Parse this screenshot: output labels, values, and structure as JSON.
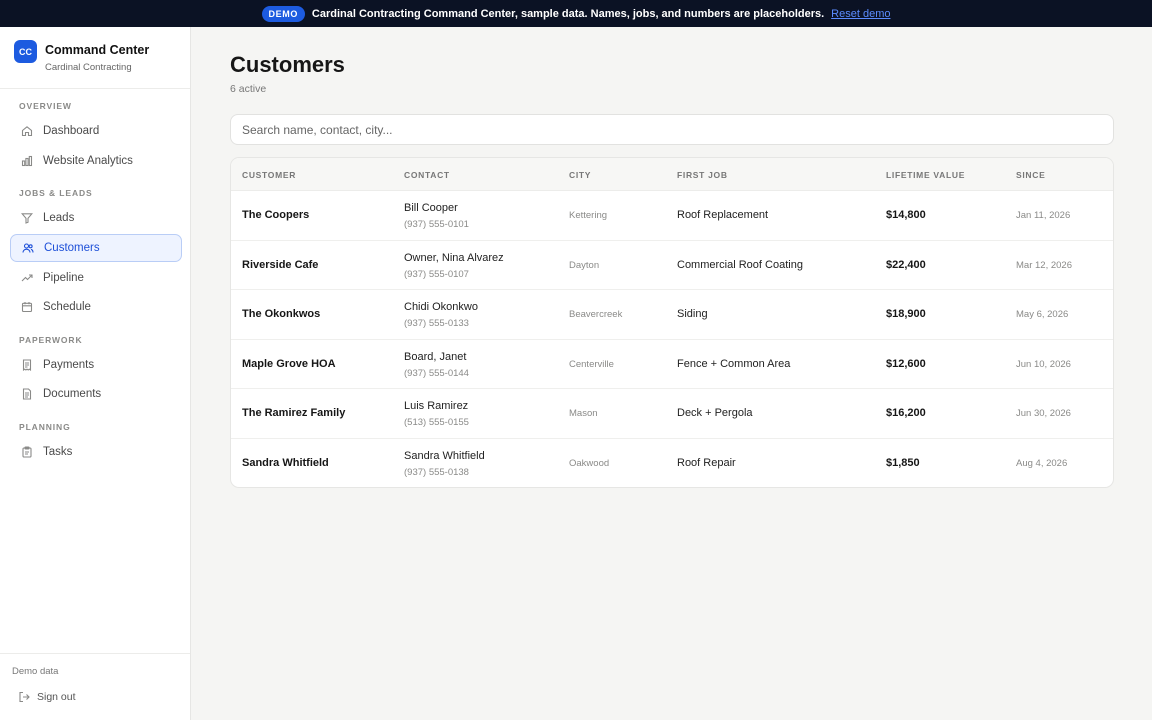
{
  "banner": {
    "badge": "DEMO",
    "message": "Cardinal Contracting Command Center, sample data. Names, jobs, and numbers are placeholders.",
    "reset_label": "Reset demo"
  },
  "brand": {
    "logo": "CC",
    "name": "Command Center",
    "company": "Cardinal Contracting",
    "accent": "#1d5be0"
  },
  "nav": {
    "sections": [
      {
        "label": "OVERVIEW"
      },
      {
        "label": "JOBS & LEADS"
      },
      {
        "label": "PAPERWORK"
      },
      {
        "label": "PLANNING"
      }
    ],
    "items": [
      {
        "label": "Dashboard",
        "icon": "home-icon"
      },
      {
        "label": "Website Analytics",
        "icon": "bar-chart-icon"
      },
      {
        "label": "Leads",
        "icon": "filter-icon"
      },
      {
        "label": "Customers",
        "icon": "users-icon",
        "active": true
      },
      {
        "label": "Pipeline",
        "icon": "trending-up-icon"
      },
      {
        "label": "Schedule",
        "icon": "calendar-icon"
      },
      {
        "label": "Payments",
        "icon": "receipt-icon"
      },
      {
        "label": "Documents",
        "icon": "file-icon"
      },
      {
        "label": "Tasks",
        "icon": "clipboard-icon"
      }
    ]
  },
  "footer": {
    "demo_label": "Demo data",
    "signout_label": "Sign out"
  },
  "page": {
    "title": "Customers",
    "subtitle": "6 active",
    "search_placeholder": "Search name, contact, city..."
  },
  "table": {
    "columns": [
      "CUSTOMER",
      "CONTACT",
      "CITY",
      "FIRST JOB",
      "LIFETIME VALUE",
      "SINCE"
    ],
    "rows": [
      {
        "customer": "The Coopers",
        "contact": "Bill Cooper",
        "phone": "(937) 555-0101",
        "city": "Kettering",
        "job": "Roof Replacement",
        "value": "$14,800",
        "since": "Jan 11, 2026"
      },
      {
        "customer": "Riverside Cafe",
        "contact": "Owner, Nina Alvarez",
        "phone": "(937) 555-0107",
        "city": "Dayton",
        "job": "Commercial Roof Coating",
        "value": "$22,400",
        "since": "Mar 12, 2026"
      },
      {
        "customer": "The Okonkwos",
        "contact": "Chidi Okonkwo",
        "phone": "(937) 555-0133",
        "city": "Beavercreek",
        "job": "Siding",
        "value": "$18,900",
        "since": "May 6, 2026"
      },
      {
        "customer": "Maple Grove HOA",
        "contact": "Board, Janet",
        "phone": "(937) 555-0144",
        "city": "Centerville",
        "job": "Fence + Common Area",
        "value": "$12,600",
        "since": "Jun 10, 2026"
      },
      {
        "customer": "The Ramirez Family",
        "contact": "Luis Ramirez",
        "phone": "(513) 555-0155",
        "city": "Mason",
        "job": "Deck + Pergola",
        "value": "$16,200",
        "since": "Jun 30, 2026"
      },
      {
        "customer": "Sandra Whitfield",
        "contact": "Sandra Whitfield",
        "phone": "(937) 555-0138",
        "city": "Oakwood",
        "job": "Roof Repair",
        "value": "$1,850",
        "since": "Aug 4, 2026"
      }
    ]
  }
}
